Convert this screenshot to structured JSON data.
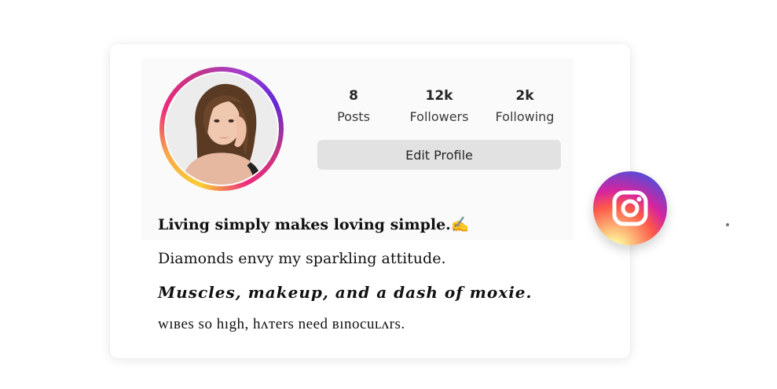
{
  "profile": {
    "stats": [
      {
        "value": "8",
        "label": "Posts"
      },
      {
        "value": "12k",
        "label": "Followers"
      },
      {
        "value": "2k",
        "label": "Following"
      }
    ],
    "edit_button_label": "Edit Profile",
    "bio_lines": [
      "Living simply makes loving simple.✍️",
      "Diamonds envy my sparkling attitude.",
      "Muscles, makeup, and a dash of moxie.",
      "wıвes so hıgh, hʌтers nееd вınocuʟʌrs."
    ]
  },
  "icons": {
    "avatar": "profile-photo",
    "logo": "instagram-icon"
  },
  "colors": {
    "card_bg": "#ffffff",
    "button_bg": "#e2e2e2",
    "ring_gradient": [
      "#f9ce34",
      "#ee2a7b",
      "#6228d7"
    ]
  }
}
